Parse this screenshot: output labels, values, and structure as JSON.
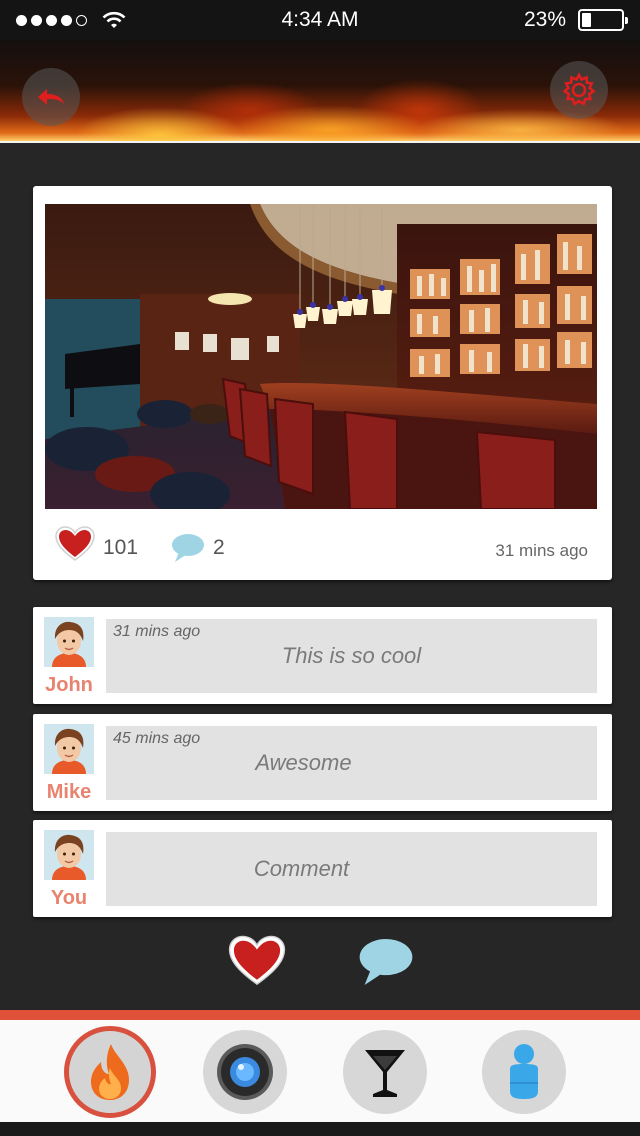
{
  "status_bar": {
    "time": "4:34 AM",
    "battery_percent": "23%",
    "battery_level": 0.23,
    "signal_bars_filled": 4,
    "signal_bars_total": 5
  },
  "header": {
    "back_icon": "back-arrow-icon",
    "settings_icon": "gear-icon"
  },
  "post": {
    "likes": "101",
    "comments": "2",
    "time": "31 mins ago"
  },
  "comments": [
    {
      "name": "John",
      "time": "31 mins ago",
      "text": "This is so cool"
    },
    {
      "name": "Mike",
      "time": "45 mins ago",
      "text": "Awesome"
    }
  ],
  "compose": {
    "name": "You",
    "placeholder": "Comment"
  },
  "tabs": [
    {
      "icon": "flame-icon",
      "active": true
    },
    {
      "icon": "camera-lens-icon",
      "active": false
    },
    {
      "icon": "cocktail-glass-icon",
      "active": false
    },
    {
      "icon": "person-icon",
      "active": false
    }
  ],
  "colors": {
    "accent": "#d8513e",
    "name_color": "#e8836f",
    "like_red": "#c81f1f",
    "bubble_blue": "#9fd4e4"
  }
}
